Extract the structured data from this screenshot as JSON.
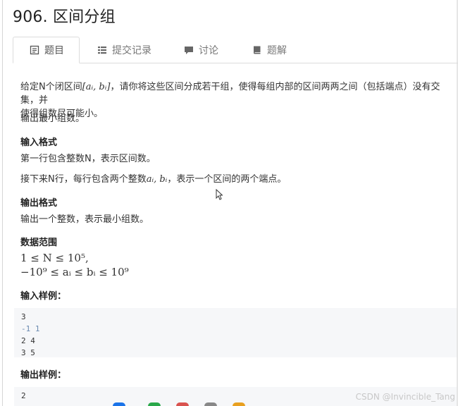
{
  "problem": {
    "title": "906. 区间分组"
  },
  "tabs": [
    {
      "label": "题目",
      "icon": "document-icon"
    },
    {
      "label": "提交记录",
      "icon": "list-icon"
    },
    {
      "label": "讨论",
      "icon": "comment-icon"
    },
    {
      "label": "题解",
      "icon": "book-icon"
    }
  ],
  "description": {
    "intro_part1": "给定N个闭区间",
    "intro_part2": "，请你将这些区间分成若干组，使得每组内部的区间两两之间（包括端点）没有交集，并",
    "intro_line2": "使得组数尽可能小。",
    "interval_math": "[aᵢ, bᵢ]",
    "output_req": "输出最小组数。"
  },
  "input_format": {
    "heading": "输入格式",
    "line1": "第一行包含整数N，表示区间数。",
    "line2_part1": "接下来N行，每行包含两个整数",
    "line2_math": "aᵢ, bᵢ",
    "line2_part2": "，表示一个区间的两个端点。"
  },
  "output_format": {
    "heading": "输出格式",
    "line1": "输出一个整数，表示最小组数。"
  },
  "data_range": {
    "heading": "数据范围",
    "line1": "1 ≤ N ≤ 10⁵,",
    "line2": "−10⁹ ≤ aᵢ ≤ bᵢ ≤ 10⁹"
  },
  "input_sample": {
    "heading": "输入样例：",
    "lines": [
      "3",
      "-1 1",
      "2 4",
      "3 5"
    ]
  },
  "output_sample": {
    "heading": "输出样例：",
    "lines": [
      "2"
    ]
  },
  "watermark": "CSDN @Invincible_Tang",
  "colors": {
    "code_bg": "#f6f7f9",
    "code_highlight": "#6a8ab0"
  }
}
